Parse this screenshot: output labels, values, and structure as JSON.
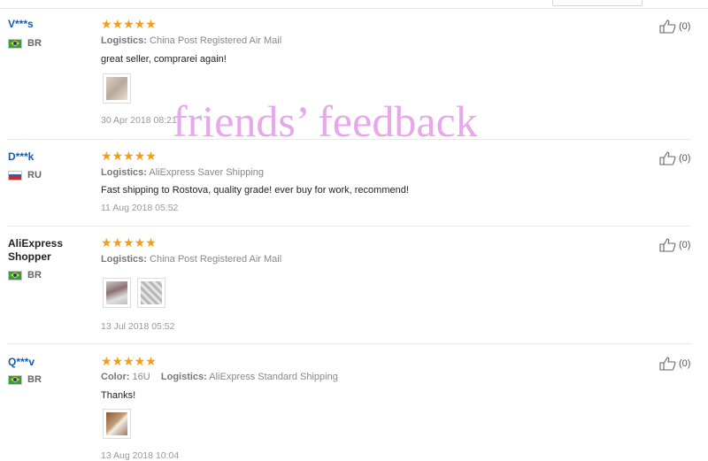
{
  "reviews": [
    {
      "user": "V***s",
      "country": "BR",
      "stars": "★★★★★",
      "logistics_label": "Logistics:",
      "logistics": "China Post Registered Air Mail",
      "text": "great seller, comprarei again!",
      "date": "30 Apr 2018 08:21",
      "likes": "(0)"
    },
    {
      "user": "D***k",
      "country": "RU",
      "stars": "★★★★★",
      "logistics_label": "Logistics:",
      "logistics": "AliExpress Saver Shipping",
      "text": "Fast shipping to Rostova, quality grade! ever buy for work, recommend!",
      "date": "11 Aug 2018 05:52",
      "likes": "(0)"
    },
    {
      "user": "AliExpress Shopper",
      "country": "BR",
      "stars": "★★★★★",
      "logistics_label": "Logistics:",
      "logistics": "China Post Registered Air Mail",
      "date": "13 Jul 2018 05:52",
      "likes": "(0)"
    },
    {
      "user": "Q***v",
      "country": "BR",
      "stars": "★★★★★",
      "color_label": "Color:",
      "color": "16U",
      "logistics_label": "Logistics:",
      "logistics": "AliExpress Standard Shipping",
      "text": "Thanks!",
      "date": "13 Aug 2018 10:04",
      "likes": "(0)"
    }
  ],
  "watermark": "friends’ feedback",
  "icons": {
    "like": "thumbs-up-icon",
    "flag_br": "brazil-flag-icon",
    "flag_ru": "russia-flag-icon"
  },
  "colors": {
    "star": "#f59c1a",
    "username": "#1a5aa8",
    "watermark": "#e6a3ea"
  }
}
